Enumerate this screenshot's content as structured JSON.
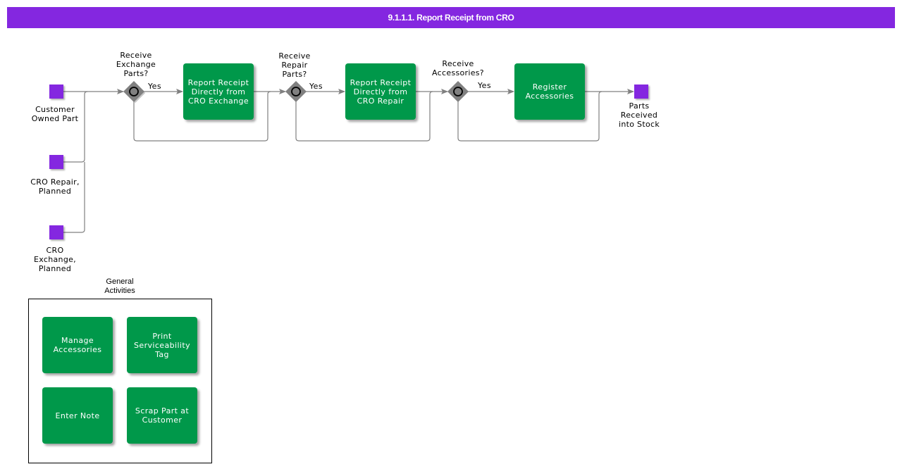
{
  "title": "9.1.1.1. Report Receipt from CRO",
  "colors": {
    "header": "#8427e0",
    "task": "#00984a",
    "event": "#8427e0",
    "gateway": "#808080",
    "connector": "#808080"
  },
  "start_events": [
    {
      "label": "Customer Owned Part"
    },
    {
      "label": "CRO Repair, Planned"
    },
    {
      "label": "CRO Exchange, Planned"
    }
  ],
  "end_event": {
    "label": "Parts Received into Stock"
  },
  "gateways": [
    {
      "label": "Receive Exchange Parts?",
      "yes_label": "Yes",
      "icon": "circle-gateway-icon"
    },
    {
      "label": "Receive Repair Parts?",
      "yes_label": "Yes",
      "icon": "circle-gateway-icon"
    },
    {
      "label": "Receive Accessories?",
      "yes_label": "Yes",
      "icon": "circle-gateway-icon"
    }
  ],
  "tasks": [
    {
      "label": "Report Receipt Directly from CRO Exchange"
    },
    {
      "label": "Report Receipt Directly from CRO Repair"
    },
    {
      "label": "Register Accessories"
    }
  ],
  "general_activities": {
    "label": "General Activities",
    "items": [
      {
        "label": "Manage Accessories"
      },
      {
        "label": "Print Serviceability Tag"
      },
      {
        "label": "Enter Note"
      },
      {
        "label": "Scrap Part at Customer"
      }
    ]
  }
}
